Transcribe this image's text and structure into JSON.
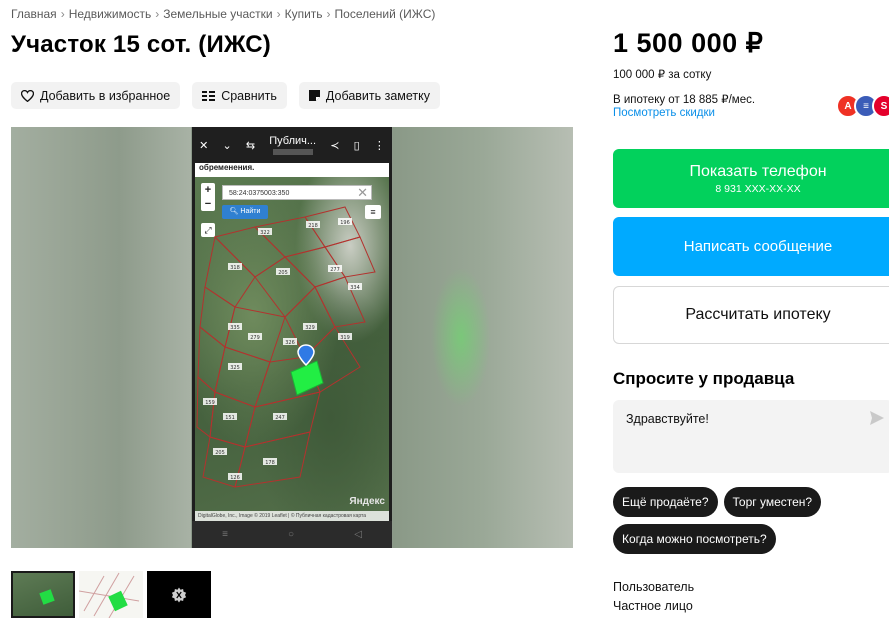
{
  "breadcrumb": [
    "Главная",
    "Недвижимость",
    "Земельные участки",
    "Купить",
    "Поселений (ИЖС)"
  ],
  "title": "Участок 15 сот. (ИЖС)",
  "actions": {
    "favorite": "Добавить в избранное",
    "compare": "Сравнить",
    "note": "Добавить заметку"
  },
  "gallery": {
    "phone_title": "Публич...",
    "map_header": "обременения.",
    "search_value": "58:24:0375003:350",
    "find_label": "Найти",
    "watermark": "Яндекс",
    "attribution": "DigitalGlobe, Inc., Image © 2019 Leaflet | © Публичная кадастровая карта",
    "parcels": [
      "322",
      "218",
      "196",
      "277",
      "318",
      "205",
      "334",
      "335",
      "279",
      "329",
      "326",
      "319",
      "325",
      "159",
      "151",
      "247",
      "205",
      "178",
      "126"
    ]
  },
  "price": "1 500 000 ₽",
  "price_per_sotka": "100 000 ₽ за сотку",
  "mortgage_text": "В ипотеку от 18 885 ₽/мес.",
  "discount_link": "Посмотреть скидки",
  "banks": [
    {
      "letter": "А",
      "color": "#ef3124"
    },
    {
      "letter": "≡",
      "color": "#3b5cb8"
    },
    {
      "letter": "S",
      "color": "#e4002b"
    }
  ],
  "buttons": {
    "phone_label": "Показать телефон",
    "phone_number": "8 931 XXX-XX-XX",
    "message": "Написать сообщение",
    "calc": "Рассчитать ипотеку"
  },
  "ask_seller": {
    "title": "Спросите у продавца",
    "message": "Здравствуйте!",
    "chips": [
      "Ещё продаёте?",
      "Торг уместен?",
      "Когда можно посмотреть?"
    ]
  },
  "seller": {
    "name": "Пользователь",
    "type": "Частное лицо"
  }
}
